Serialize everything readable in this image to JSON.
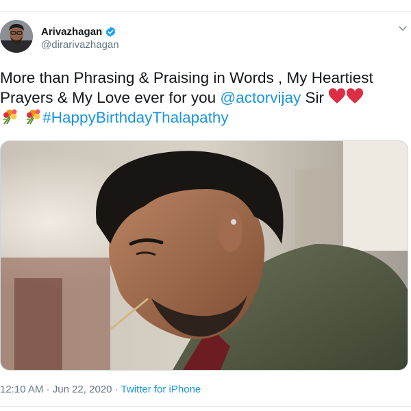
{
  "author": {
    "display_name": "Arivazhagan",
    "handle": "@dirarivazhagan",
    "verified": true,
    "avatar_icon": "avatar-photo-icon",
    "verified_icon": "verified-badge-icon"
  },
  "menu_icon": "chevron-down-icon",
  "tweet": {
    "text_part1": "More than Phrasing & Praising in Words , My Heartiest Prayers & My Love ever for you ",
    "mention": "@actorvijay",
    "text_part2": " Sir ",
    "hashtag": "#HappyBirthdayThalapathy",
    "emoji_icons": [
      "red-heart-icon",
      "red-heart-icon",
      "bouquet-icon",
      "bouquet-icon"
    ]
  },
  "media": {
    "type": "photo",
    "icon": "photo-man-profile-icon"
  },
  "meta": {
    "time": "12:10 AM",
    "separator1": " · ",
    "date": "Jun 22, 2020",
    "separator2": " · ",
    "source": "Twitter for iPhone"
  },
  "colors": {
    "link": "#1b95e0",
    "secondary_text": "#657786",
    "primary_text": "#14171a",
    "verified": "#1da1f2",
    "border": "#e6ecf0"
  }
}
